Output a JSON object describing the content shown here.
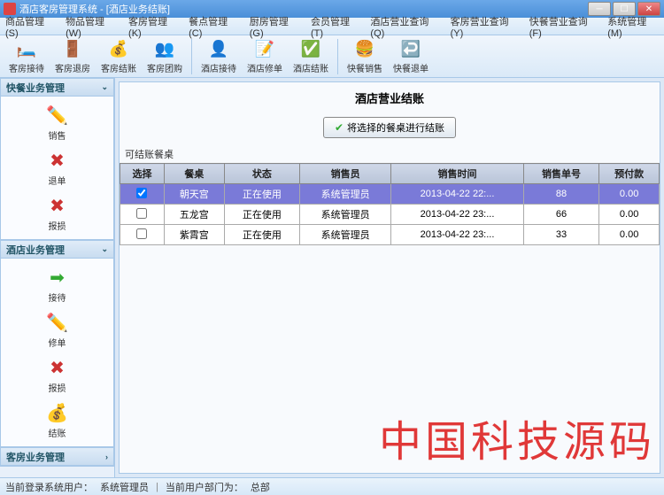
{
  "window": {
    "title": "酒店客房管理系统 - [酒店业务结账]"
  },
  "menu": [
    "商品管理(S)",
    "物品管理(W)",
    "客房管理(K)",
    "餐点管理(C)",
    "厨房管理(G)",
    "会员管理(T)",
    "酒店营业查询(Q)",
    "客房营业查询(Y)",
    "快餐营业查询(F)",
    "系统管理(M)"
  ],
  "toolbar": [
    {
      "label": "客房接待",
      "icon": "🛏️"
    },
    {
      "label": "客房退房",
      "icon": "🚪"
    },
    {
      "label": "客房结账",
      "icon": "💰"
    },
    {
      "label": "客房团购",
      "icon": "👥"
    },
    {
      "sep": true
    },
    {
      "label": "酒店接待",
      "icon": "👤"
    },
    {
      "label": "酒店修单",
      "icon": "📝"
    },
    {
      "label": "酒店结账",
      "icon": "✅"
    },
    {
      "sep": true
    },
    {
      "label": "快餐销售",
      "icon": "🍔"
    },
    {
      "label": "快餐退单",
      "icon": "↩️"
    }
  ],
  "sidebar": {
    "sections": [
      {
        "title": "快餐业务管理",
        "expanded": true,
        "items": [
          {
            "label": "销售",
            "icon": "✏️",
            "color": "#d80"
          },
          {
            "label": "退单",
            "icon": "✖",
            "color": "#c33"
          },
          {
            "label": "报损",
            "icon": "✖",
            "color": "#c33"
          }
        ]
      },
      {
        "title": "酒店业务管理",
        "expanded": true,
        "items": [
          {
            "label": "接待",
            "icon": "➡",
            "color": "#3a3"
          },
          {
            "label": "修单",
            "icon": "✏️",
            "color": "#d80"
          },
          {
            "label": "报损",
            "icon": "✖",
            "color": "#c33"
          },
          {
            "label": "结账",
            "icon": "💰",
            "color": "#880"
          }
        ]
      },
      {
        "title": "客房业务管理",
        "expanded": false,
        "items": []
      }
    ]
  },
  "main": {
    "title": "酒店营业结账",
    "action_button": "将选择的餐桌进行结账",
    "section_label": "可结账餐桌",
    "columns": [
      "选择",
      "餐桌",
      "状态",
      "销售员",
      "销售时间",
      "销售单号",
      "预付款"
    ],
    "rows": [
      {
        "selected": true,
        "checked": true,
        "table": "朝天宫",
        "status": "正在使用",
        "seller": "系统管理员",
        "time": "2013-04-22 22:...",
        "order": "88",
        "prepay": "0.00"
      },
      {
        "selected": false,
        "checked": false,
        "table": "五龙宫",
        "status": "正在使用",
        "seller": "系统管理员",
        "time": "2013-04-22 23:...",
        "order": "66",
        "prepay": "0.00"
      },
      {
        "selected": false,
        "checked": false,
        "table": "紫霄宫",
        "status": "正在使用",
        "seller": "系统管理员",
        "time": "2013-04-22 23:...",
        "order": "33",
        "prepay": "0.00"
      }
    ]
  },
  "statusbar": {
    "user_label": "当前登录系统用户：",
    "user": "系统管理员",
    "dept_label": "当前用户部门为：",
    "dept": "总部"
  },
  "watermark": "中国科技源码"
}
